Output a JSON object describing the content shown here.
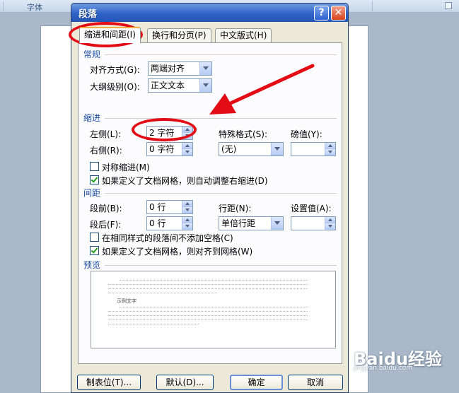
{
  "background": {
    "ribbon_label": "字体",
    "accent": "#3a5a86"
  },
  "dialog": {
    "title": "段落",
    "help_glyph": "?",
    "close_glyph": "✕",
    "tabs": [
      {
        "label": "缩进和间距(I)",
        "active": true
      },
      {
        "label": "换行和分页(P)",
        "active": false
      },
      {
        "label": "中文版式(H)",
        "active": false
      }
    ],
    "general": {
      "title": "常规",
      "alignment_label": "对齐方式(G):",
      "alignment_value": "两端对齐",
      "outline_label": "大纲级别(O):",
      "outline_value": "正文文本"
    },
    "indent": {
      "title": "缩进",
      "left_label": "左侧(L):",
      "left_value": "2 字符",
      "right_label": "右侧(R):",
      "right_value": "0 字符",
      "special_label": "特殊格式(S):",
      "special_value": "(无)",
      "by_label": "磅值(Y):",
      "by_value": "",
      "mirror_label": "对称缩进(M)",
      "mirror_checked": false,
      "auto_adjust_label": "如果定义了文档网格，则自动调整右缩进(D)",
      "auto_adjust_checked": true
    },
    "spacing": {
      "title": "间距",
      "before_label": "段前(B):",
      "before_value": "0 行",
      "after_label": "段后(F):",
      "after_value": "0 行",
      "line_spacing_label": "行距(N):",
      "line_spacing_value": "单倍行距",
      "at_label": "设置值(A):",
      "at_value": "",
      "no_space_label": "在相同样式的段落间不添加空格(C)",
      "no_space_checked": false,
      "snap_grid_label": "如果定义了文档网格，则对齐到网格(W)",
      "snap_grid_checked": true
    },
    "preview": {
      "title": "预览",
      "sample_text": "示例文字"
    },
    "buttons": {
      "tabs": "制表位(T)...",
      "default": "默认(D)...",
      "ok": "确定",
      "cancel": "取消"
    }
  },
  "watermark": {
    "text": "Baidu经验",
    "sub": "jingyan.baidu.com"
  },
  "colors": {
    "title_bar": "#2f63c7",
    "section_title": "#1b4ba5",
    "highlight": "#e30b14",
    "check": "#21a121"
  }
}
